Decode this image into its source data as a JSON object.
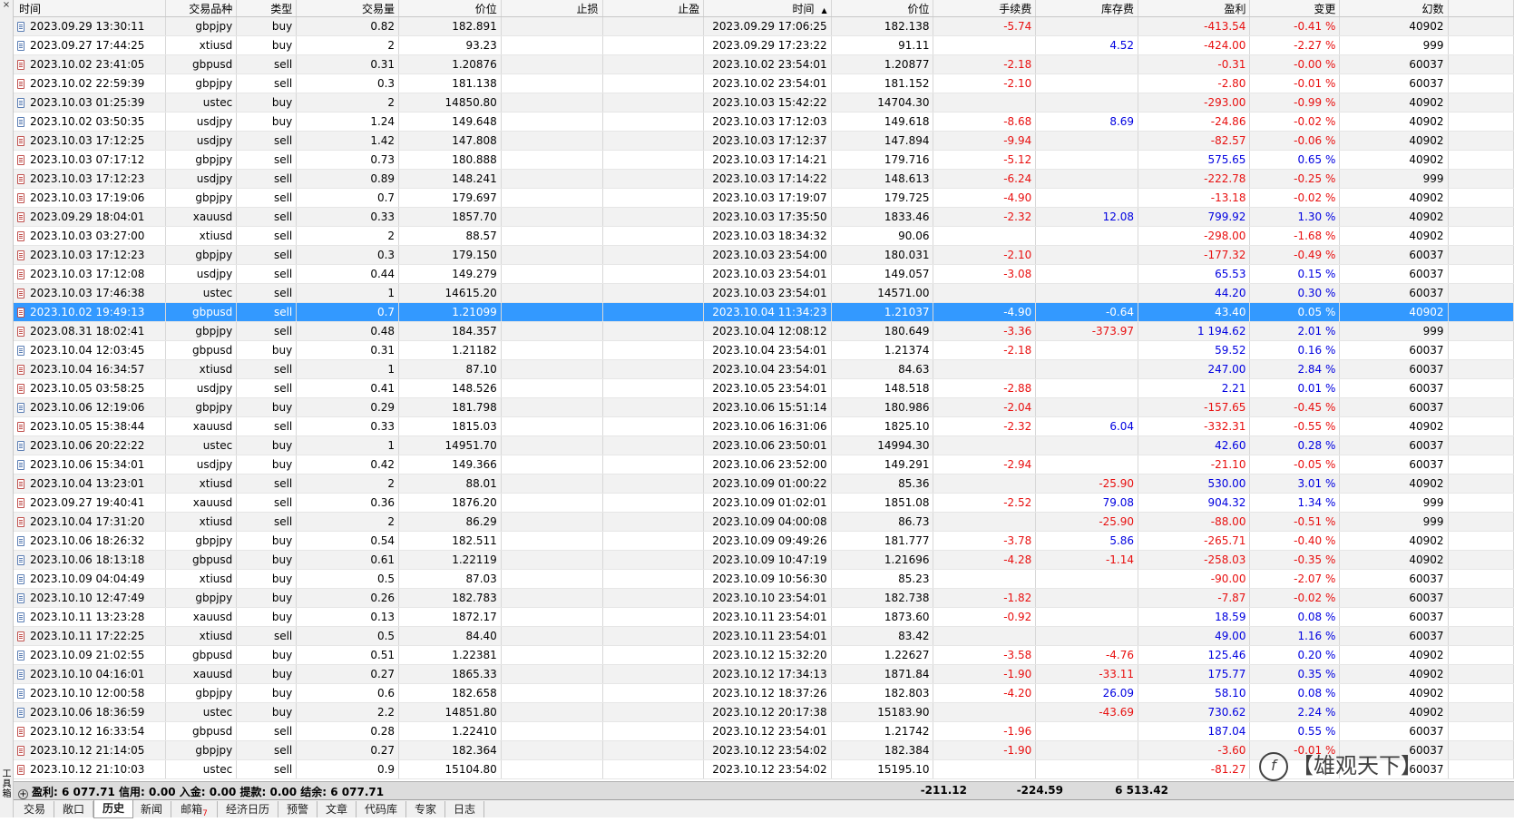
{
  "side_label": "工具箱",
  "columns": [
    "时间",
    "交易品种",
    "类型",
    "交易量",
    "价位",
    "止损",
    "止盈",
    "时间",
    "价位",
    "手续费",
    "库存费",
    "盈利",
    "变更",
    "幻数"
  ],
  "rows": [
    [
      "2023.09.29 13:30:11",
      "gbpjpy",
      "buy",
      "0.82",
      "182.891",
      "",
      "",
      "2023.09.29 17:06:25",
      "182.138",
      "-5.74",
      "",
      "-413.54",
      "-0.41 %",
      "40902"
    ],
    [
      "2023.09.27 17:44:25",
      "xtiusd",
      "buy",
      "2",
      "93.23",
      "",
      "",
      "2023.09.29 17:23:22",
      "91.11",
      "",
      "4.52",
      "-424.00",
      "-2.27 %",
      "999"
    ],
    [
      "2023.10.02 23:41:05",
      "gbpusd",
      "sell",
      "0.31",
      "1.20876",
      "",
      "",
      "2023.10.02 23:54:01",
      "1.20877",
      "-2.18",
      "",
      "-0.31",
      "-0.00 %",
      "60037"
    ],
    [
      "2023.10.02 22:59:39",
      "gbpjpy",
      "sell",
      "0.3",
      "181.138",
      "",
      "",
      "2023.10.02 23:54:01",
      "181.152",
      "-2.10",
      "",
      "-2.80",
      "-0.01 %",
      "60037"
    ],
    [
      "2023.10.03 01:25:39",
      "ustec",
      "buy",
      "2",
      "14850.80",
      "",
      "",
      "2023.10.03 15:42:22",
      "14704.30",
      "",
      "",
      "-293.00",
      "-0.99 %",
      "40902"
    ],
    [
      "2023.10.02 03:50:35",
      "usdjpy",
      "buy",
      "1.24",
      "149.648",
      "",
      "",
      "2023.10.03 17:12:03",
      "149.618",
      "-8.68",
      "8.69",
      "-24.86",
      "-0.02 %",
      "40902"
    ],
    [
      "2023.10.03 17:12:25",
      "usdjpy",
      "sell",
      "1.42",
      "147.808",
      "",
      "",
      "2023.10.03 17:12:37",
      "147.894",
      "-9.94",
      "",
      "-82.57",
      "-0.06 %",
      "40902"
    ],
    [
      "2023.10.03 07:17:12",
      "gbpjpy",
      "sell",
      "0.73",
      "180.888",
      "",
      "",
      "2023.10.03 17:14:21",
      "179.716",
      "-5.12",
      "",
      "575.65",
      "0.65 %",
      "40902"
    ],
    [
      "2023.10.03 17:12:23",
      "usdjpy",
      "sell",
      "0.89",
      "148.241",
      "",
      "",
      "2023.10.03 17:14:22",
      "148.613",
      "-6.24",
      "",
      "-222.78",
      "-0.25 %",
      "999"
    ],
    [
      "2023.10.03 17:19:06",
      "gbpjpy",
      "sell",
      "0.7",
      "179.697",
      "",
      "",
      "2023.10.03 17:19:07",
      "179.725",
      "-4.90",
      "",
      "-13.18",
      "-0.02 %",
      "40902"
    ],
    [
      "2023.09.29 18:04:01",
      "xauusd",
      "sell",
      "0.33",
      "1857.70",
      "",
      "",
      "2023.10.03 17:35:50",
      "1833.46",
      "-2.32",
      "12.08",
      "799.92",
      "1.30 %",
      "40902"
    ],
    [
      "2023.10.03 03:27:00",
      "xtiusd",
      "sell",
      "2",
      "88.57",
      "",
      "",
      "2023.10.03 18:34:32",
      "90.06",
      "",
      "",
      "-298.00",
      "-1.68 %",
      "40902"
    ],
    [
      "2023.10.03 17:12:23",
      "gbpjpy",
      "sell",
      "0.3",
      "179.150",
      "",
      "",
      "2023.10.03 23:54:00",
      "180.031",
      "-2.10",
      "",
      "-177.32",
      "-0.49 %",
      "60037"
    ],
    [
      "2023.10.03 17:12:08",
      "usdjpy",
      "sell",
      "0.44",
      "149.279",
      "",
      "",
      "2023.10.03 23:54:01",
      "149.057",
      "-3.08",
      "",
      "65.53",
      "0.15 %",
      "60037"
    ],
    [
      "2023.10.03 17:46:38",
      "ustec",
      "sell",
      "1",
      "14615.20",
      "",
      "",
      "2023.10.03 23:54:01",
      "14571.00",
      "",
      "",
      "44.20",
      "0.30 %",
      "60037"
    ],
    [
      "2023.10.02 19:49:13",
      "gbpusd",
      "sell",
      "0.7",
      "1.21099",
      "",
      "",
      "2023.10.04 11:34:23",
      "1.21037",
      "-4.90",
      "-0.64",
      "43.40",
      "0.05 %",
      "40902"
    ],
    [
      "2023.08.31 18:02:41",
      "gbpjpy",
      "sell",
      "0.48",
      "184.357",
      "",
      "",
      "2023.10.04 12:08:12",
      "180.649",
      "-3.36",
      "-373.97",
      "1 194.62",
      "2.01 %",
      "999"
    ],
    [
      "2023.10.04 12:03:45",
      "gbpusd",
      "buy",
      "0.31",
      "1.21182",
      "",
      "",
      "2023.10.04 23:54:01",
      "1.21374",
      "-2.18",
      "",
      "59.52",
      "0.16 %",
      "60037"
    ],
    [
      "2023.10.04 16:34:57",
      "xtiusd",
      "sell",
      "1",
      "87.10",
      "",
      "",
      "2023.10.04 23:54:01",
      "84.63",
      "",
      "",
      "247.00",
      "2.84 %",
      "60037"
    ],
    [
      "2023.10.05 03:58:25",
      "usdjpy",
      "sell",
      "0.41",
      "148.526",
      "",
      "",
      "2023.10.05 23:54:01",
      "148.518",
      "-2.88",
      "",
      "2.21",
      "0.01 %",
      "60037"
    ],
    [
      "2023.10.06 12:19:06",
      "gbpjpy",
      "buy",
      "0.29",
      "181.798",
      "",
      "",
      "2023.10.06 15:51:14",
      "180.986",
      "-2.04",
      "",
      "-157.65",
      "-0.45 %",
      "60037"
    ],
    [
      "2023.10.05 15:38:44",
      "xauusd",
      "sell",
      "0.33",
      "1815.03",
      "",
      "",
      "2023.10.06 16:31:06",
      "1825.10",
      "-2.32",
      "6.04",
      "-332.31",
      "-0.55 %",
      "40902"
    ],
    [
      "2023.10.06 20:22:22",
      "ustec",
      "buy",
      "1",
      "14951.70",
      "",
      "",
      "2023.10.06 23:50:01",
      "14994.30",
      "",
      "",
      "42.60",
      "0.28 %",
      "60037"
    ],
    [
      "2023.10.06 15:34:01",
      "usdjpy",
      "buy",
      "0.42",
      "149.366",
      "",
      "",
      "2023.10.06 23:52:00",
      "149.291",
      "-2.94",
      "",
      "-21.10",
      "-0.05 %",
      "60037"
    ],
    [
      "2023.10.04 13:23:01",
      "xtiusd",
      "sell",
      "2",
      "88.01",
      "",
      "",
      "2023.10.09 01:00:22",
      "85.36",
      "",
      "-25.90",
      "530.00",
      "3.01 %",
      "40902"
    ],
    [
      "2023.09.27 19:40:41",
      "xauusd",
      "sell",
      "0.36",
      "1876.20",
      "",
      "",
      "2023.10.09 01:02:01",
      "1851.08",
      "-2.52",
      "79.08",
      "904.32",
      "1.34 %",
      "999"
    ],
    [
      "2023.10.04 17:31:20",
      "xtiusd",
      "sell",
      "2",
      "86.29",
      "",
      "",
      "2023.10.09 04:00:08",
      "86.73",
      "",
      "-25.90",
      "-88.00",
      "-0.51 %",
      "999"
    ],
    [
      "2023.10.06 18:26:32",
      "gbpjpy",
      "buy",
      "0.54",
      "182.511",
      "",
      "",
      "2023.10.09 09:49:26",
      "181.777",
      "-3.78",
      "5.86",
      "-265.71",
      "-0.40 %",
      "40902"
    ],
    [
      "2023.10.06 18:13:18",
      "gbpusd",
      "buy",
      "0.61",
      "1.22119",
      "",
      "",
      "2023.10.09 10:47:19",
      "1.21696",
      "-4.28",
      "-1.14",
      "-258.03",
      "-0.35 %",
      "40902"
    ],
    [
      "2023.10.09 04:04:49",
      "xtiusd",
      "buy",
      "0.5",
      "87.03",
      "",
      "",
      "2023.10.09 10:56:30",
      "85.23",
      "",
      "",
      "-90.00",
      "-2.07 %",
      "60037"
    ],
    [
      "2023.10.10 12:47:49",
      "gbpjpy",
      "buy",
      "0.26",
      "182.783",
      "",
      "",
      "2023.10.10 23:54:01",
      "182.738",
      "-1.82",
      "",
      "-7.87",
      "-0.02 %",
      "60037"
    ],
    [
      "2023.10.11 13:23:28",
      "xauusd",
      "buy",
      "0.13",
      "1872.17",
      "",
      "",
      "2023.10.11 23:54:01",
      "1873.60",
      "-0.92",
      "",
      "18.59",
      "0.08 %",
      "60037"
    ],
    [
      "2023.10.11 17:22:25",
      "xtiusd",
      "sell",
      "0.5",
      "84.40",
      "",
      "",
      "2023.10.11 23:54:01",
      "83.42",
      "",
      "",
      "49.00",
      "1.16 %",
      "60037"
    ],
    [
      "2023.10.09 21:02:55",
      "gbpusd",
      "buy",
      "0.51",
      "1.22381",
      "",
      "",
      "2023.10.12 15:32:20",
      "1.22627",
      "-3.58",
      "-4.76",
      "125.46",
      "0.20 %",
      "40902"
    ],
    [
      "2023.10.10 04:16:01",
      "xauusd",
      "buy",
      "0.27",
      "1865.33",
      "",
      "",
      "2023.10.12 17:34:13",
      "1871.84",
      "-1.90",
      "-33.11",
      "175.77",
      "0.35 %",
      "40902"
    ],
    [
      "2023.10.10 12:00:58",
      "gbpjpy",
      "buy",
      "0.6",
      "182.658",
      "",
      "",
      "2023.10.12 18:37:26",
      "182.803",
      "-4.20",
      "26.09",
      "58.10",
      "0.08 %",
      "40902"
    ],
    [
      "2023.10.06 18:36:59",
      "ustec",
      "buy",
      "2.2",
      "14851.80",
      "",
      "",
      "2023.10.12 20:17:38",
      "15183.90",
      "",
      "-43.69",
      "730.62",
      "2.24 %",
      "40902"
    ],
    [
      "2023.10.12 16:33:54",
      "gbpusd",
      "sell",
      "0.28",
      "1.22410",
      "",
      "",
      "2023.10.12 23:54:01",
      "1.21742",
      "-1.96",
      "",
      "187.04",
      "0.55 %",
      "60037"
    ],
    [
      "2023.10.12 21:14:05",
      "gbpjpy",
      "sell",
      "0.27",
      "182.364",
      "",
      "",
      "2023.10.12 23:54:02",
      "182.384",
      "-1.90",
      "",
      "-3.60",
      "-0.01 %",
      "60037"
    ],
    [
      "2023.10.12 21:10:03",
      "ustec",
      "sell",
      "0.9",
      "15104.80",
      "",
      "",
      "2023.10.12 23:54:02",
      "15195.10",
      "",
      "",
      "-81.27",
      "",
      "60037"
    ]
  ],
  "selected_row": 15,
  "footer": {
    "summary": "盈利: 6 077.71  信用: 0.00  入金: 0.00  提款: 0.00  结余: 6 077.71",
    "commission_total": "-211.12",
    "swap_total": "-224.59",
    "profit_total": "6 513.42"
  },
  "tabs": [
    {
      "label": "交易"
    },
    {
      "label": "敞口"
    },
    {
      "label": "历史",
      "active": true
    },
    {
      "label": "新闻"
    },
    {
      "label": "邮箱",
      "badge": "7"
    },
    {
      "label": "经济日历"
    },
    {
      "label": "预警"
    },
    {
      "label": "文章"
    },
    {
      "label": "代码库"
    },
    {
      "label": "专家"
    },
    {
      "label": "日志"
    }
  ],
  "watermark": "【雄观天下】",
  "colors": {
    "negative": "#e81010",
    "positive": "#0000e0",
    "selected": "#3399ff"
  }
}
